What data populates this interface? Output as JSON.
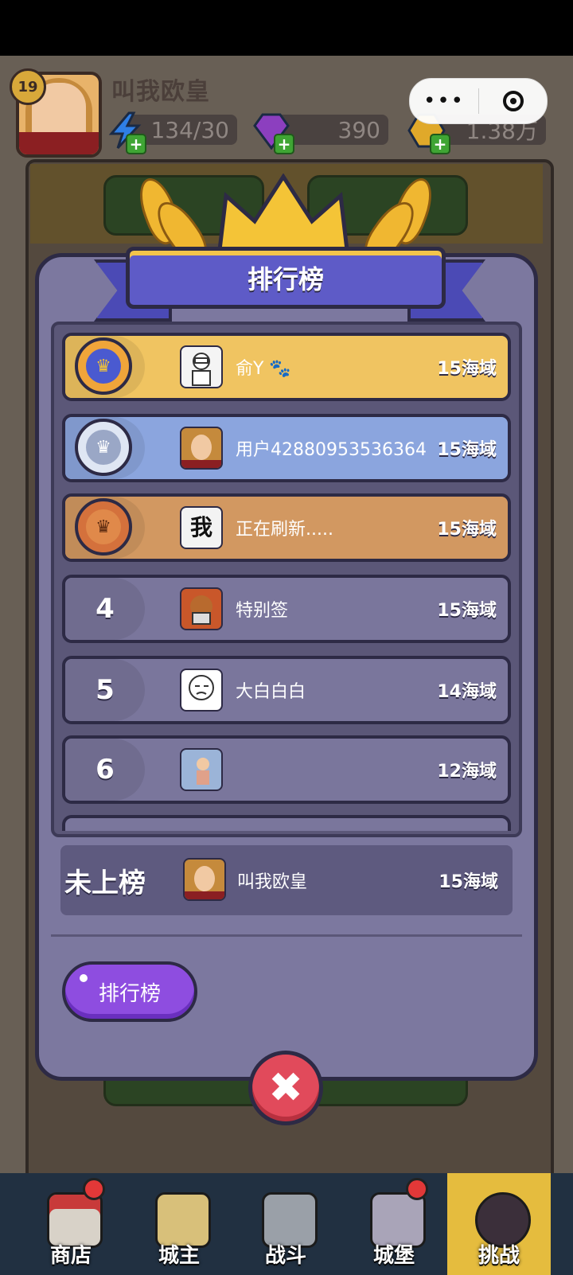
{
  "header": {
    "level": "19",
    "player_name": "叫我欧皇",
    "energy": "134/30",
    "gems": "390",
    "gold": "1.38万"
  },
  "leaderboard": {
    "title": "排行榜",
    "rows": [
      {
        "rank": "1",
        "name": "俞Y 🐾",
        "score": "15海域"
      },
      {
        "rank": "2",
        "name": "用户42880953536364",
        "score": "15海域"
      },
      {
        "rank": "3",
        "name": "正在刷新.....",
        "score": "15海域"
      },
      {
        "rank": "4",
        "name": "特别签",
        "score": "15海域"
      },
      {
        "rank": "5",
        "name": "大白白白",
        "score": "14海域"
      },
      {
        "rank": "6",
        "name": "",
        "score": "12海域"
      }
    ],
    "self": {
      "rank_label": "未上榜",
      "name": "叫我欧皇",
      "score": "15海域"
    },
    "button_label": "排行榜",
    "close_symbol": "✖"
  },
  "nav": [
    {
      "label": "商店"
    },
    {
      "label": "城主"
    },
    {
      "label": "战斗"
    },
    {
      "label": "城堡"
    },
    {
      "label": "挑战"
    }
  ],
  "colors": {
    "panel": "#7c789f",
    "gold_row": "#f0c461",
    "silver_row": "#8ba5de",
    "bronze_row": "#d29861",
    "plain_row": "#7a769c",
    "button_purple": "#8e4de0",
    "close_red": "#e14a5b"
  }
}
